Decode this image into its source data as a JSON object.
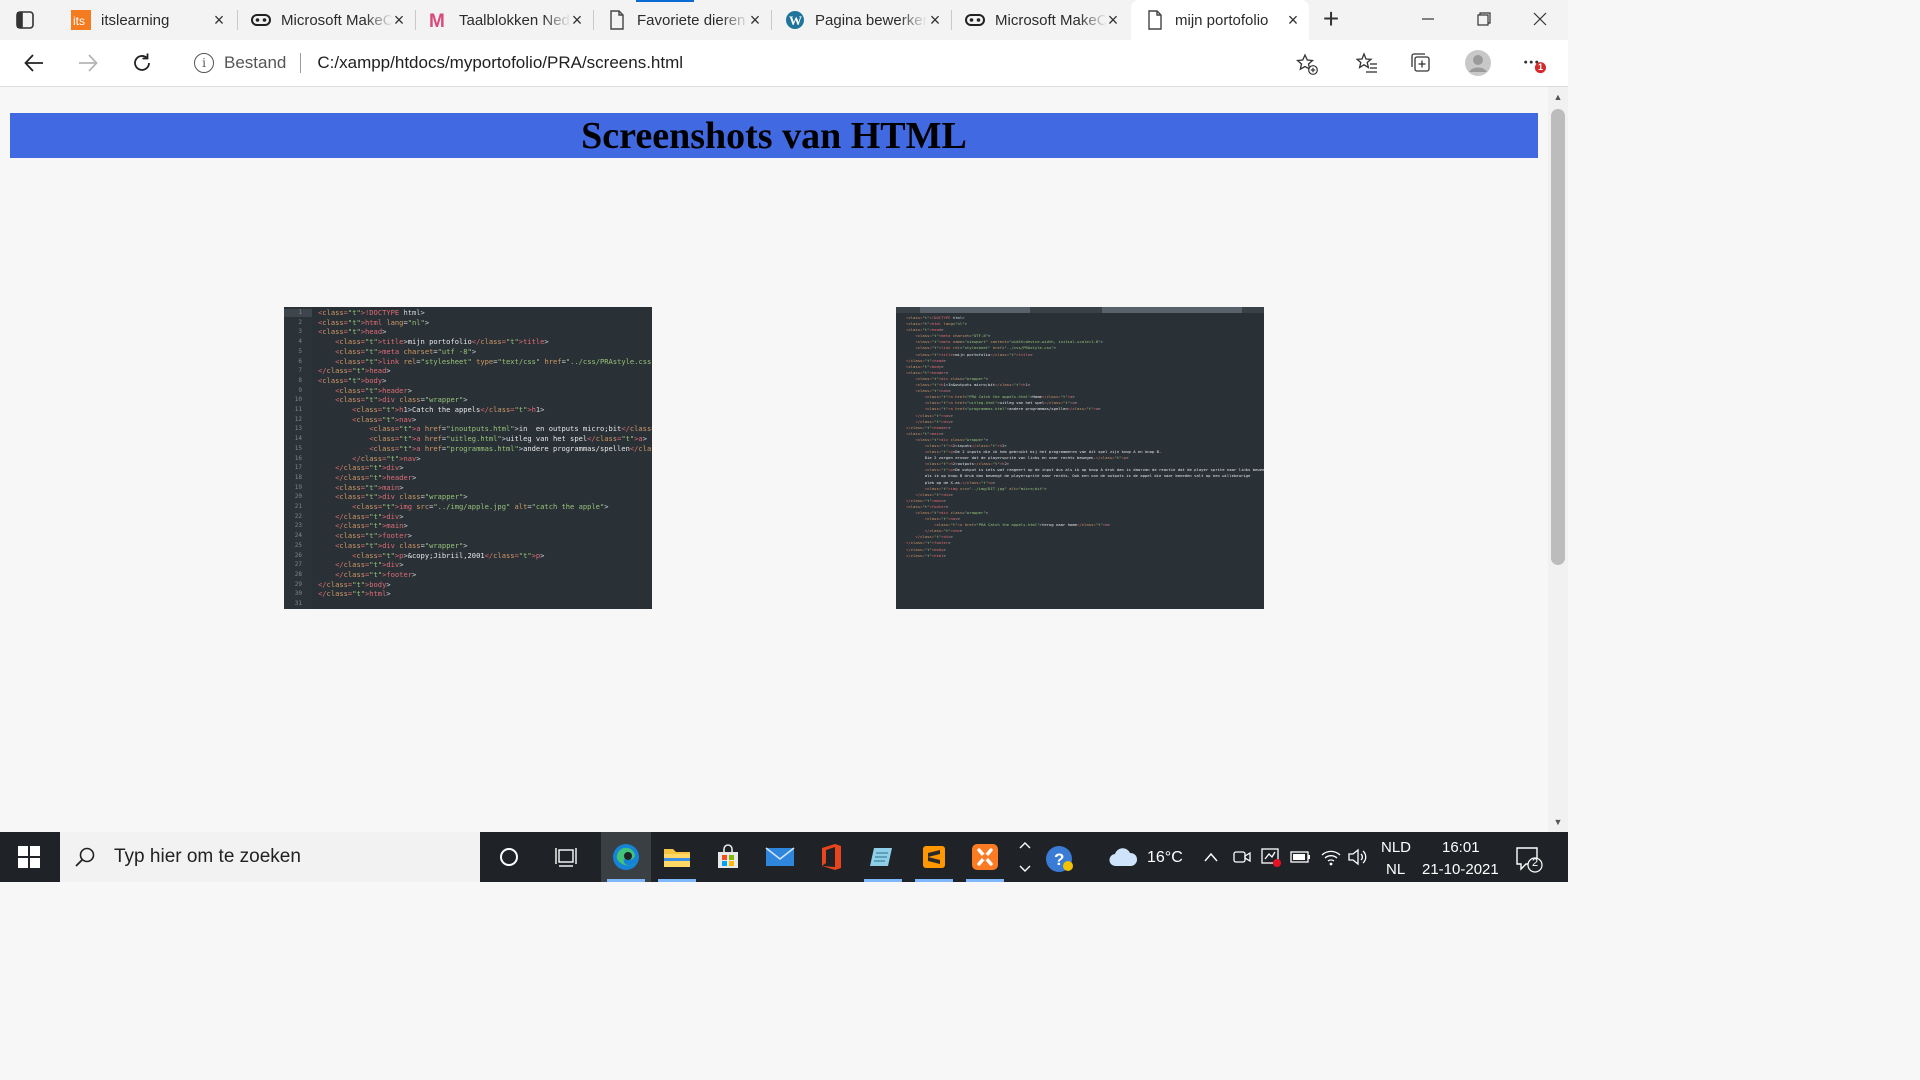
{
  "browser": {
    "tabs": [
      {
        "title": "itslearning",
        "favicon": "itslearning-icon"
      },
      {
        "title": "Microsoft MakeCode",
        "favicon": "makecode-icon"
      },
      {
        "title": "Taalblokken Nederlands",
        "favicon": "m-logo-icon"
      },
      {
        "title": "Favoriete dieren",
        "favicon": "page-icon"
      },
      {
        "title": "Pagina bewerken",
        "favicon": "wordpress-icon"
      },
      {
        "title": "Microsoft MakeCode",
        "favicon": "makecode-icon"
      },
      {
        "title": "mijn portofolio",
        "favicon": "page-icon",
        "active": true
      }
    ],
    "address": {
      "scheme_label": "Bestand",
      "url": "C:/xampp/htdocs/myportofolio/PRA/screens.html"
    },
    "notification_badge": "1"
  },
  "page": {
    "title": "Screenshots van HTML",
    "header_color": "#4169e1",
    "screenshot1": {
      "line_numbers": "1\n2\n3\n4\n5\n6\n7\n8\n9\n10\n11\n12\n13\n14\n15\n16\n17\n18\n19\n20\n21\n22\n23\n24\n25\n26\n27\n28\n29\n30\n31",
      "code_lines": [
        "<!DOCTYPE html>",
        "<html lang=\"nl\">",
        "<head>",
        "    <title>mijn portofolio</title>",
        "    <meta charset=\"utf -8\">",
        "    <link rel=\"stylesheet\" type=\"text/css\" href=\"../css/PRAstyle.css\">",
        "</head>",
        "<body>",
        "    <header>",
        "    <div class=\"wrapper\">",
        "        <h1>Catch the appels</h1>",
        "        <nav>",
        "            <a href=\"inoutputs.html\">in  en outputs micro;bit</a>",
        "            <a href=\"uitleg.html\">uitleg van het spel</a>",
        "            <a href=\"programmas.html\">andere programmas/spellen</a>",
        "        </nav>",
        "    </div>",
        "    </header>",
        "    <main>",
        "    <div class=\"wrapper\">",
        "        <img src=\"../img/apple.jpg\" alt=\"catch the apple\">",
        "    </div>",
        "    </main>",
        "    <footer>",
        "    <div class=\"wrapper\">",
        "        <p>&copy;Jibriil,2001</p>",
        "    </div>",
        "    </footer>",
        "</body>",
        "</html>"
      ]
    },
    "screenshot2": {
      "code_lines": [
        "<!DOCTYPE html>",
        "<html lang=\"nl\">",
        "<head>",
        "    <meta charset=\"UTF-8\">",
        "    <meta name=\"viewport\" content=\"width=device-width, initial-scale=1.0\">",
        "    <link rel=\"stylesheet\" href=\"../css/PRAstyle.css\">",
        "    <title>mijn portofolio</title>",
        "</head>",
        "<body>",
        "<header>",
        "    <div class=\"wrapper\">",
        "    <h1>In&outputs micro;bit</h1>",
        "    <nav>",
        "        <a href=\"PRA Catch the appels.html\">Home</a>",
        "        <a href=\"uitleg.html\">uitleg van het spel</a>",
        "        <a href=\"programmas.html\">andere programmas/spellen</a>",
        "    </nav>",
        "    </div>",
        "</header>",
        "<main>",
        "    <div class=\"wrapper\">",
        "        <h2>inputs</h2>",
        "        <p>De 2 inputs die ik heb gebruikt bij het programmeren van dit spel zijn knop A en knop B.",
        "        Die 2 zorgen ervoor dat de playersprite van links en naar rechts bewegen.</p>",
        "        <h2>outputs</h2>",
        "        <p>De output is iets wat reageert op de input dus als ik op knop A druk dan is daarvan de reactie dat de player sprite naar links beweegt en",
        "        als ik op knop B druk dan beweegt de playersprite naar rechts. Ook een van de outputs is de appel die naar beneden valt op een willekeurige",
        "        plek op de X-as.</p>",
        "        <img src=\"../img/DIT.jpg\" alt=\"micro;bit\">",
        "    </div>",
        "</main>",
        "<footer>",
        "    <div class=\"wrapper\">",
        "        <nav>",
        "            <a href=\"PRA Catch the appels.html\">terug naar home</a>",
        "        </nav>",
        "    </div>",
        "</footer>",
        "</body>",
        "</html>"
      ]
    }
  },
  "taskbar": {
    "search_placeholder": "Typ hier om te zoeken",
    "weather_temp": "16°C",
    "lang_top": "NLD",
    "lang_bottom": "NL",
    "time": "16:01",
    "date": "21-10-2021",
    "notification_count": "2"
  }
}
